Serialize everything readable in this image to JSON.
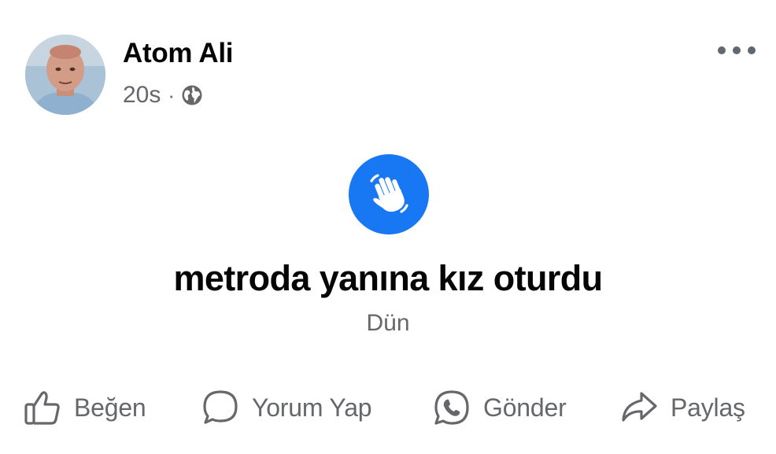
{
  "post": {
    "author": "Atom Ali",
    "time": "20s",
    "separator": "·",
    "audience_icon": "globe-icon",
    "more_icon": "more-options-icon",
    "status_icon": "waving-hand-icon",
    "status_text": "metroda yanına kız oturdu",
    "status_date": "Dün"
  },
  "actions": {
    "like": {
      "label": "Beğen",
      "icon": "thumbs-up-icon"
    },
    "comment": {
      "label": "Yorum Yap",
      "icon": "comment-bubble-icon"
    },
    "send": {
      "label": "Gönder",
      "icon": "whatsapp-icon"
    },
    "share": {
      "label": "Paylaş",
      "icon": "share-arrow-icon"
    }
  },
  "colors": {
    "accent": "#1877f2",
    "text_primary": "#050505",
    "text_secondary": "#65676b",
    "background": "#ffffff"
  }
}
